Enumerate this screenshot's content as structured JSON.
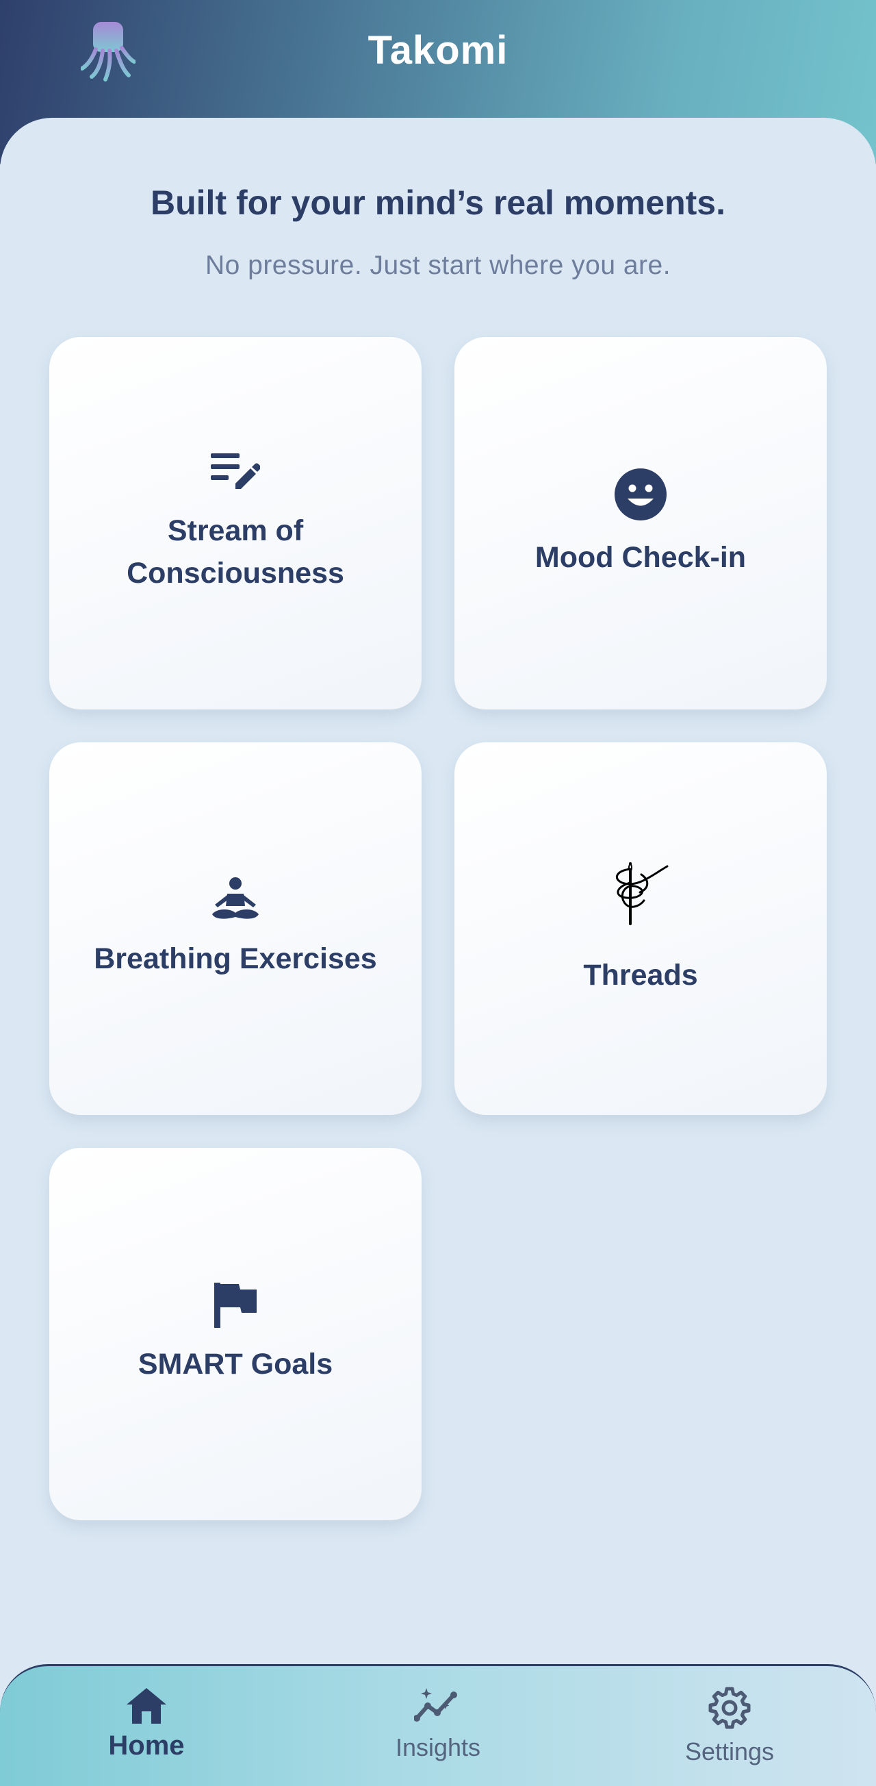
{
  "app": {
    "title": "Takomi"
  },
  "hero": {
    "headline": "Built for your mind’s real moments.",
    "subline": "No pressure. Just start where you are."
  },
  "cards": [
    {
      "label_line1": "Stream of",
      "label_line2": "Consciousness",
      "icon": "notes-edit-icon"
    },
    {
      "label": "Mood Check-in",
      "icon": "smiley-face-icon"
    },
    {
      "label": "Breathing Exercises",
      "icon": "meditation-icon"
    },
    {
      "label": "Threads",
      "icon": "needle-thread-icon"
    },
    {
      "label": "SMART Goals",
      "icon": "flag-icon"
    }
  ],
  "nav": {
    "items": [
      {
        "label": "Home",
        "icon": "home-icon",
        "active": true
      },
      {
        "label": "Insights",
        "icon": "insights-icon",
        "active": false
      },
      {
        "label": "Settings",
        "icon": "gear-icon",
        "active": false
      }
    ]
  },
  "colors": {
    "primary_text": "#2d3e66",
    "muted_text": "#6e7d9b",
    "background": "#dbe8f4",
    "header_start": "#2e3f6b",
    "header_end": "#74c3cc"
  }
}
